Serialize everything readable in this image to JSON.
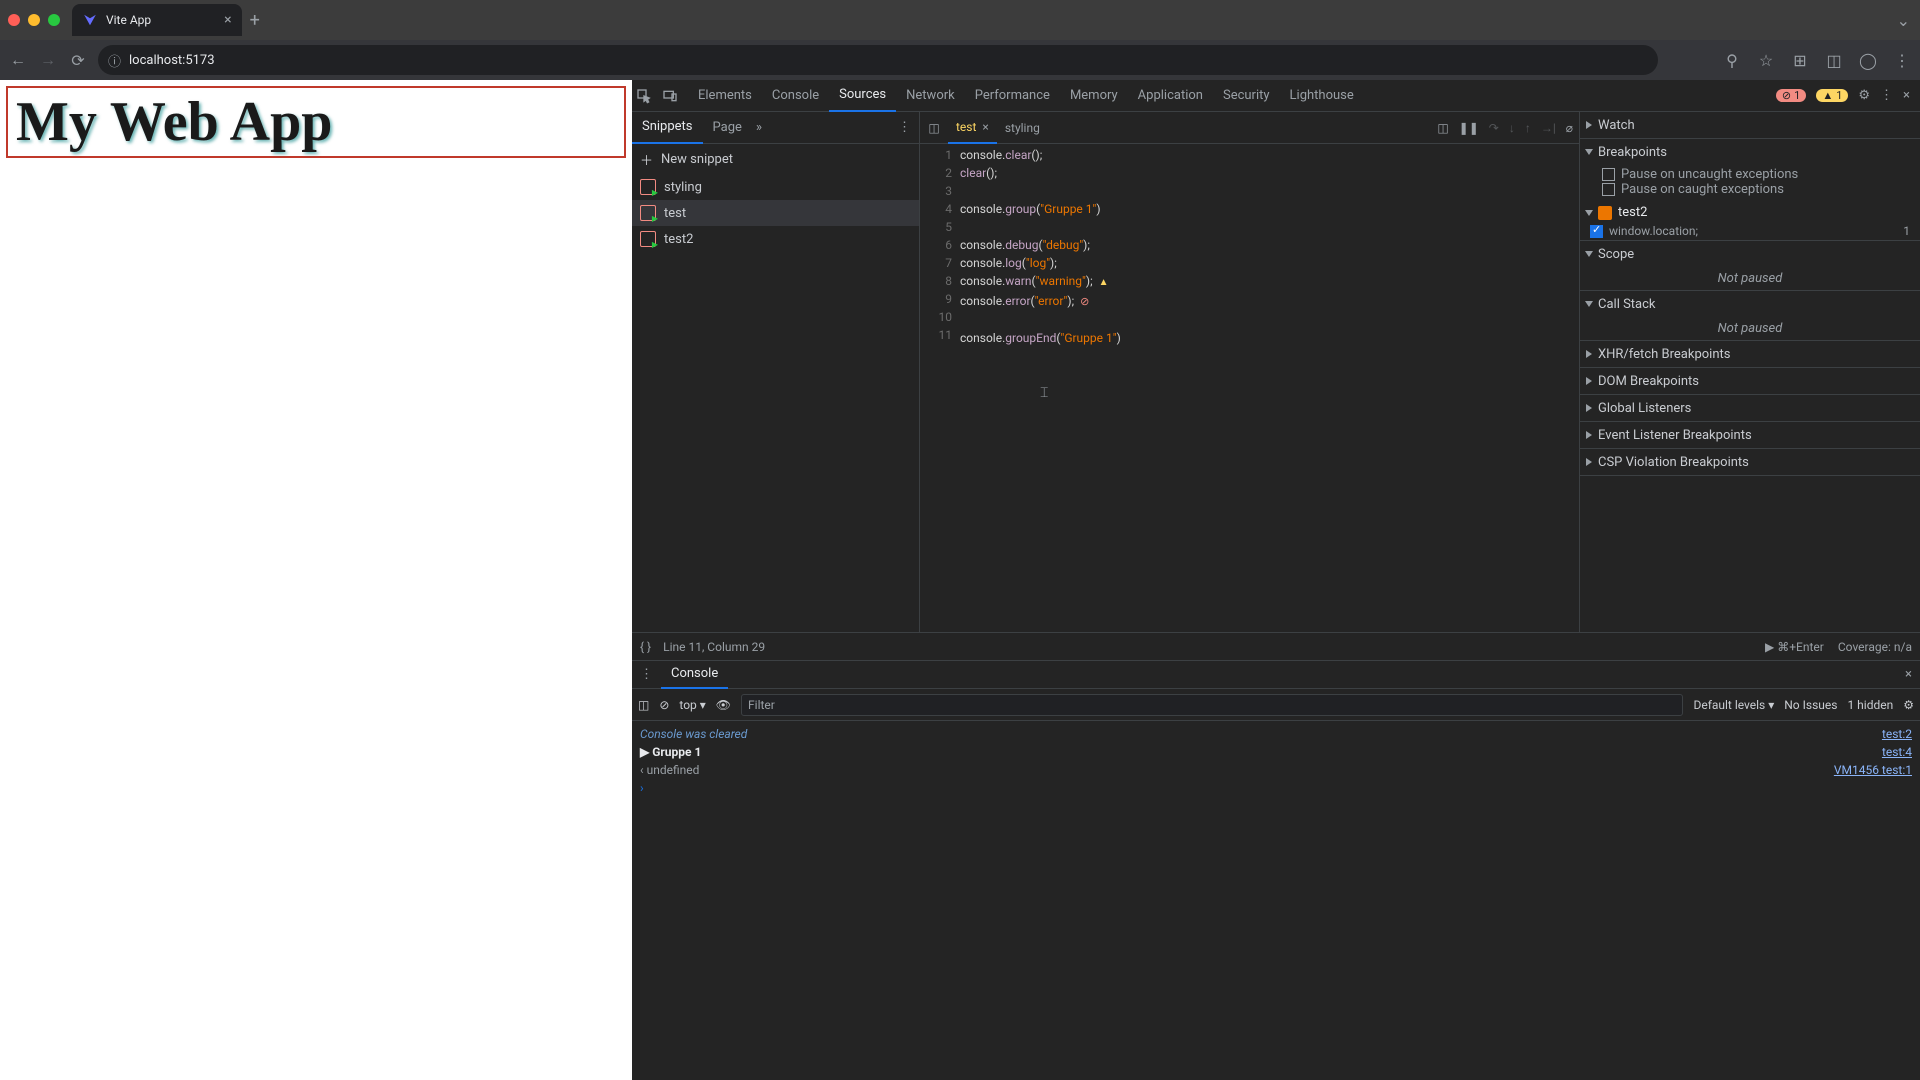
{
  "browser": {
    "tab_title": "Vite App",
    "url": "localhost:5173"
  },
  "page": {
    "heading": "My Web App"
  },
  "devtools": {
    "tabs": [
      "Elements",
      "Console",
      "Sources",
      "Network",
      "Performance",
      "Memory",
      "Application",
      "Security",
      "Lighthouse"
    ],
    "active_tab": "Sources",
    "error_count": "1",
    "warn_count": "1"
  },
  "navigator": {
    "tabs": [
      "Snippets",
      "Page"
    ],
    "active": "Snippets",
    "new_snippet": "New snippet",
    "snippets": [
      "styling",
      "test",
      "test2"
    ],
    "selected": "test"
  },
  "editor": {
    "tabs": [
      "test",
      "styling"
    ],
    "active": "test",
    "code": [
      {
        "n": "1",
        "html": "<span class='k-id'>console</span>.<span class='k-fn'>clear</span>();"
      },
      {
        "n": "2",
        "html": "<span class='k-fn'>clear</span>();"
      },
      {
        "n": "3",
        "html": ""
      },
      {
        "n": "4",
        "html": "<span class='k-id'>console</span>.<span class='k-fn'>group</span>(<span class='k-str'>\"Gruppe 1\"</span>)"
      },
      {
        "n": "5",
        "html": ""
      },
      {
        "n": "6",
        "html": "<span class='k-id'>console</span>.<span class='k-fn'>debug</span>(<span class='k-str'>\"debug\"</span>);"
      },
      {
        "n": "7",
        "html": "<span class='k-id'>console</span>.<span class='k-fn'>log</span>(<span class='k-str'>\"log\"</span>);"
      },
      {
        "n": "8",
        "html": "<span class='k-id'>console</span>.<span class='k-fn'>warn</span>(<span class='k-str'>\"warning\"</span>);",
        "cls": "ln-warn"
      },
      {
        "n": "9",
        "html": "<span class='k-id'>console</span>.<span class='k-fn'>error</span>(<span class='k-str'>\"error\"</span>);",
        "cls": "ln-err"
      },
      {
        "n": "10",
        "html": ""
      },
      {
        "n": "11",
        "html": "<span class='k-id'>console</span>.<span class='k-fn'>groupEnd</span>(<span class='k-str'>\"Gruppe 1\"</span>)"
      }
    ],
    "status": "Line 11, Column 29",
    "run_hint": "⌘+Enter",
    "coverage": "Coverage: n/a"
  },
  "debugger": {
    "watch": "Watch",
    "breakpoints": {
      "title": "Breakpoints",
      "uncaught": "Pause on uncaught exceptions",
      "caught": "Pause on caught exceptions",
      "file": "test2",
      "expr": "window.location;",
      "line": "1"
    },
    "scope": {
      "title": "Scope",
      "msg": "Not paused"
    },
    "callstack": {
      "title": "Call Stack",
      "msg": "Not paused"
    },
    "xhr": "XHR/fetch Breakpoints",
    "dom": "DOM Breakpoints",
    "global": "Global Listeners",
    "event": "Event Listener Breakpoints",
    "csp": "CSP Violation Breakpoints"
  },
  "console": {
    "tab": "Console",
    "context": "top",
    "filter_placeholder": "Filter",
    "levels": "Default levels",
    "issues": "No Issues",
    "hidden": "1 hidden",
    "rows": [
      {
        "cls": "cleared",
        "text": "Console was cleared",
        "link": "test:2"
      },
      {
        "cls": "grp",
        "pre": "▶ ",
        "text": "Gruppe 1",
        "link": "test:4"
      },
      {
        "cls": "undef",
        "pre": "‹ ",
        "text": "undefined",
        "link": "VM1456 test:1"
      }
    ]
  }
}
